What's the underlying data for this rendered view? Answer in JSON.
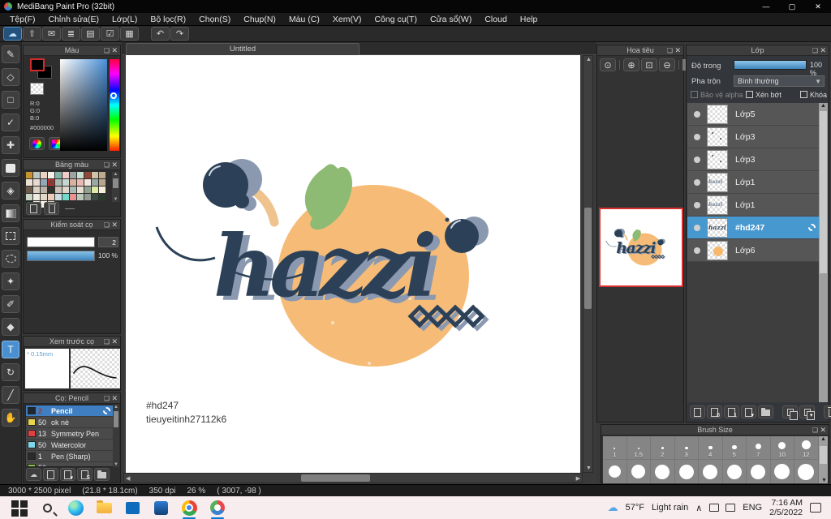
{
  "window": {
    "title": "MediBang Paint Pro (32bit)"
  },
  "menubar": {
    "items": [
      "Tệp(F)",
      "Chỉnh sửa(E)",
      "Lớp(L)",
      "Bộ lọc(R)",
      "Chọn(S)",
      "Chụp(N)",
      "Màu (C)",
      "Xem(V)",
      "Công cụ(T)",
      "Cửa sổ(W)",
      "Cloud",
      "Help"
    ]
  },
  "toolbar": {
    "icons": [
      {
        "name": "cloud-sync-icon",
        "glyph": "☁",
        "active": true
      },
      {
        "name": "upload-icon",
        "glyph": "⇧"
      },
      {
        "name": "comment-icon",
        "glyph": "✉"
      },
      {
        "name": "comment-list-icon",
        "glyph": "≣"
      },
      {
        "name": "document-icon",
        "glyph": "▤"
      },
      {
        "name": "list-settings-icon",
        "glyph": "☑"
      },
      {
        "name": "canvas-settings-icon",
        "glyph": "▦"
      },
      {
        "name": "undo-icon",
        "glyph": "↶",
        "group": 2
      },
      {
        "name": "redo-icon",
        "glyph": "↷",
        "group": 2
      }
    ]
  },
  "tools": [
    {
      "name": "brush-tool",
      "glyph": "✎"
    },
    {
      "name": "eraser-tool",
      "glyph": "◇"
    },
    {
      "name": "shape-brush-tool",
      "glyph": "□"
    },
    {
      "name": "operation-tool",
      "glyph": "✓"
    },
    {
      "name": "move-tool",
      "glyph": "✚"
    },
    {
      "name": "fill-rect-tool",
      "shape": "fill"
    },
    {
      "name": "bucket-tool",
      "glyph": "◈"
    },
    {
      "name": "gradient-tool",
      "shape": "gradient"
    },
    {
      "name": "select-rect-tool",
      "shape": "dashed-rect"
    },
    {
      "name": "lasso-tool",
      "shape": "dashed-ellipse"
    },
    {
      "name": "magic-wand-tool",
      "glyph": "✦"
    },
    {
      "name": "select-pen-tool",
      "glyph": "✐"
    },
    {
      "name": "select-eraser-tool",
      "glyph": "◆"
    },
    {
      "name": "text-tool",
      "glyph": "T",
      "active": true
    },
    {
      "name": "rotate-tool",
      "glyph": "↻"
    },
    {
      "name": "eyedropper-tool",
      "glyph": "╱"
    },
    {
      "name": "hand-tool",
      "glyph": "✋"
    }
  ],
  "panels": {
    "color": {
      "title": "Màu",
      "r": "R:0",
      "g": "G:0",
      "b": "B:0",
      "hex": "#000000"
    },
    "palette": {
      "title": "Bảng màu",
      "selected_index": 14,
      "swatches": [
        "#c8922f",
        "#b9c6c2",
        "#e9d2c6",
        "#f3f0ea",
        "#83b5ab",
        "#f0cbc8",
        "#9ba4a3",
        "#c7e0d2",
        "#8e4b3b",
        "#d1c2a7",
        "#c0a98c",
        "#e9e1d3",
        "#ead9cf",
        "#91a8b7",
        "#7c3c37",
        "#a9b9b0",
        "#c4d8d1",
        "#dab09f",
        "#e8bab2",
        "#f1e5dc",
        "#98a9a5",
        "#b9a58e",
        "#6d5c4c",
        "#dad1c4",
        "#bab0a4",
        "#30302c",
        "#cac0b4",
        "#e0d6ca",
        "#aabab2",
        "#eaded2",
        "#91a291",
        "#dfe8a5",
        "#f4eedb",
        "#cbd5c6",
        "#f1ebde",
        "#e2d8c8",
        "#eacaba",
        "#cadee2",
        "#72dac9",
        "#ea9292",
        "#bacaba",
        "#929a92",
        "#3a4a42",
        "#2a3a2a",
        "#1a2a1a",
        "#eaeada",
        "#faf2e2",
        "#d2d2c2"
      ],
      "footer": [
        {
          "name": "add-color-button",
          "cls": "ic-doc"
        },
        {
          "name": "delete-color-button",
          "cls": "ic-trash"
        }
      ]
    },
    "brush_control": {
      "title": "Kiểm soát cọ",
      "size_value": "2",
      "opacity_value": "100 %"
    },
    "brush_preview": {
      "title": "Xem trước cọ",
      "size_label": "0.15mm"
    },
    "brushes": {
      "title": "Cọ: Pencil",
      "items": [
        {
          "color": "#20262e",
          "size": "2",
          "name": "Pencil",
          "selected": true,
          "size_color": "#a33"
        },
        {
          "color": "#e8d44d",
          "size": "50",
          "name": "ok nè"
        },
        {
          "color": "#e04040",
          "size": "13",
          "name": "Symmetry Pen"
        },
        {
          "color": "#7fd8ec",
          "size": "50",
          "name": "Watercolor"
        },
        {
          "color": "#2a2a2a",
          "size": "1",
          "name": "Pen (Sharp)"
        },
        {
          "color": "#8bc34a",
          "size": "50",
          "name": ""
        }
      ],
      "footer": [
        {
          "name": "cloud-brush-button",
          "cls": "",
          "txt": "☁"
        },
        {
          "name": "add-brush-button",
          "cls": "ic-doc"
        },
        {
          "name": "add-brush-menu-button",
          "cls": "ic-doc",
          "ch": "▾"
        },
        {
          "name": "script-brush-button",
          "cls": "ic-doc",
          "ch": "S"
        },
        {
          "name": "brush-folder-button",
          "cls": "ic-folder"
        }
      ]
    },
    "navigator": {
      "title": "Hoa tiêu",
      "buttons": [
        {
          "name": "zoom-100-button",
          "glyph": "⊙"
        },
        {
          "name": "zoom-in-button",
          "glyph": "⊕"
        },
        {
          "name": "zoom-fit-button",
          "glyph": "⊡"
        },
        {
          "name": "zoom-out-button",
          "glyph": "⊖"
        }
      ]
    },
    "layers": {
      "title": "Lớp",
      "opacity_label": "Độ trong",
      "opacity_value": "100 %",
      "blend_label": "Pha trộn",
      "blend_value": "Bình thường",
      "checkboxes": [
        {
          "label": "Bảo vệ alpha",
          "dim": true
        },
        {
          "label": "Xén bớt"
        },
        {
          "label": "Khóa"
        }
      ],
      "items": [
        {
          "name": "Lớp5",
          "thumb": "empty"
        },
        {
          "name": "Lớp3",
          "thumb": "dots"
        },
        {
          "name": "Lớp3",
          "thumb": "dots"
        },
        {
          "name": "Lớp1",
          "thumb": "script"
        },
        {
          "name": "Lớp1",
          "thumb": "script"
        },
        {
          "name": "#hd247",
          "thumb": "text",
          "selected": true
        },
        {
          "name": "Lớp6",
          "thumb": "orange"
        }
      ],
      "footer": [
        {
          "name": "add-layer-button",
          "cls": "ic-doc"
        },
        {
          "name": "add-8bit-layer-button",
          "cls": "ic-doc",
          "ch": "8"
        },
        {
          "name": "add-1bit-layer-button",
          "cls": "ic-doc",
          "ch": "1"
        },
        {
          "name": "add-layer-menu-button",
          "cls": "ic-doc",
          "ch": "▾"
        },
        {
          "name": "new-folder-button",
          "cls": "ic-folder"
        },
        {
          "name": "sp"
        },
        {
          "name": "duplicate-layer-button",
          "cls": "ic-dup"
        },
        {
          "name": "merge-layer-button",
          "cls": "ic-dup",
          "ch": "▾"
        },
        {
          "name": "sp"
        },
        {
          "name": "delete-layer-button",
          "cls": "ic-trash"
        }
      ]
    },
    "brush_size": {
      "title": "Brush Size",
      "row1": [
        {
          "label": "1",
          "d": 2
        },
        {
          "label": "1.5",
          "d": 2.5
        },
        {
          "label": "2",
          "d": 3
        },
        {
          "label": "3",
          "d": 3.5
        },
        {
          "label": "4",
          "d": 4.5
        },
        {
          "label": "5",
          "d": 5.5
        },
        {
          "label": "7",
          "d": 7
        },
        {
          "label": "10",
          "d": 9
        },
        {
          "label": "12",
          "d": 11
        }
      ],
      "row2_d": [
        15,
        17,
        18,
        18,
        18,
        18,
        18,
        19,
        20
      ]
    }
  },
  "canvas": {
    "tab": "Untitled",
    "note_line1": "#hd247",
    "note_line2": "tieuyeitinh27112k6"
  },
  "artwork": {
    "word": "hazzi",
    "orange": "#f6bc77",
    "leaf": "#8dbb73",
    "navy": "#2c4157",
    "shadow": "#8b99b0"
  },
  "statusbar": {
    "dimensions": "3000 * 2500 pixel",
    "size_cm": "(21.8 * 18.1cm)",
    "dpi": "350 dpi",
    "zoom": "26 %",
    "coords": "( 3007, -98 )"
  },
  "taskbar": {
    "icons": [
      "start-icon",
      "search-icon",
      "edge-icon",
      "explorer-icon",
      "store-icon",
      "word-icon",
      "chrome-icon",
      "medibang-icon"
    ],
    "running": [
      "chrome-icon",
      "medibang-icon"
    ],
    "weather_temp": "57°F",
    "weather_desc": "Light rain",
    "chevron": "∧",
    "lang": "ENG",
    "time": "7:16 AM",
    "date": "2/5/2022"
  }
}
